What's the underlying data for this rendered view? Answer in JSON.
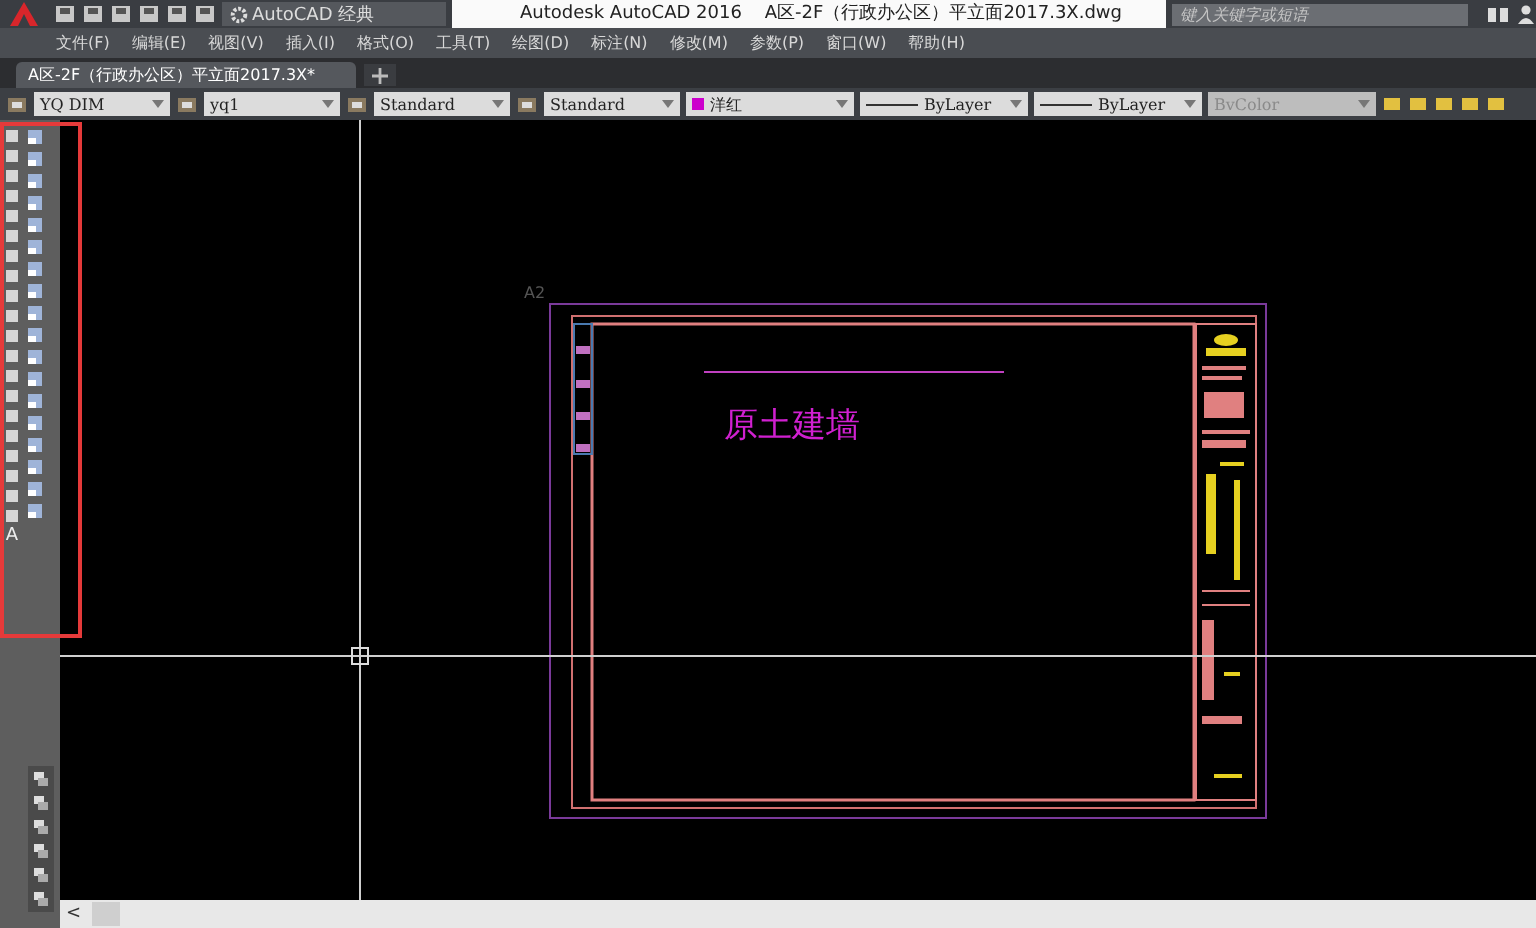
{
  "title_bar": {
    "workspace": "AutoCAD 经典",
    "title": "Autodesk AutoCAD 2016    A区-2F（行政办公区）平立面2017.3X.dwg",
    "search": {
      "placeholder": "键入关键字或短语"
    }
  },
  "menu": [
    "文件(F)",
    "编辑(E)",
    "视图(V)",
    "插入(I)",
    "格式(O)",
    "工具(T)",
    "绘图(D)",
    "标注(N)",
    "修改(M)",
    "参数(P)",
    "窗口(W)",
    "帮助(H)"
  ],
  "tabs": [
    {
      "label": "A区-2F（行政办公区）平立面2017.3X*",
      "selected": true
    }
  ],
  "toolbar": [
    {
      "kind": "style",
      "label": "YQ DIM",
      "disabled": false
    },
    {
      "kind": "style",
      "label": "yq1",
      "disabled": false
    },
    {
      "kind": "style",
      "label": "Standard",
      "disabled": false
    },
    {
      "kind": "style",
      "label": "Standard",
      "disabled": false
    },
    {
      "kind": "color",
      "label": "洋红",
      "color": "#cc00cc",
      "disabled": false
    },
    {
      "kind": "linetype",
      "label": "ByLayer",
      "disabled": false
    },
    {
      "kind": "linetype",
      "label": "ByLayer",
      "disabled": false
    },
    {
      "kind": "plot",
      "label": "BvColor",
      "disabled": true
    }
  ],
  "left_toolbar": {
    "text_tool": "A"
  },
  "drawing": {
    "sheet_label": "A2",
    "note": "原土建墙"
  },
  "scrollbar": {
    "arrow": "<"
  }
}
